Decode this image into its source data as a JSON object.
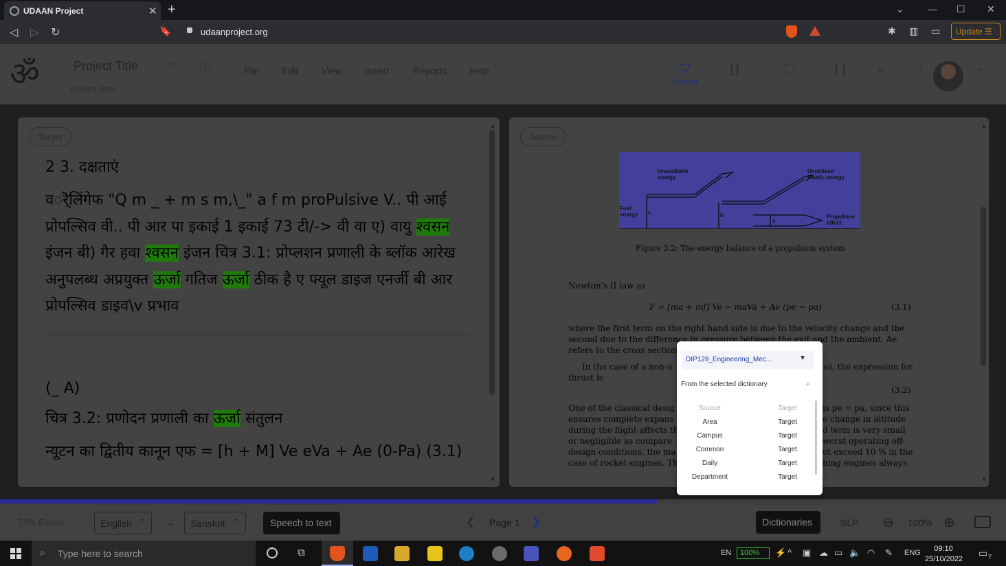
{
  "browser": {
    "tab_title": "UDAAN Project",
    "url": "udaanproject.org",
    "update_label": "Update"
  },
  "header": {
    "project_title": "Project Title",
    "file_name": "untitled.docx",
    "menu": [
      "File",
      "Edit",
      "View",
      "Insert",
      "Reports",
      "Help"
    ],
    "elements_label": "Elements"
  },
  "target_panel": {
    "chip": "Target",
    "heading": "2 3. दक्षताएं",
    "lines": [
      [
        "वर्ॆलिंगेफ \"Q m _ + m s m,\\_\" a f m proPulsive V.. पी आई",
        ""
      ],
      [
        "प्रोपल्सिव वी.. पी आर पा इकाई 1 इकाई 73 टी/-> वी वा ए) वायु ",
        "श्वसन"
      ],
      [
        "इंजन बी) गैर हवा ",
        "श्वसन",
        " इंजन चित्र 3.1: प्रोप्लशन प्रणाली के ब्लॉक आरेख"
      ],
      [
        "अनुपलब्ध अप्रयुक्त ",
        "ऊर्जा",
        " गतिज ",
        "ऊर्जा",
        " ठीक है ए फ्यूल डाइज एनर्जी बी आर"
      ],
      [
        "प्रोपल्सिव डाइव\\v प्रभाव"
      ]
    ],
    "section": "(_ A)",
    "caption_pre": "चित्र 3.2: प्रणोदन प्रणाली का ",
    "caption_hl": "ऊर्जा",
    "caption_post": " संतुलन",
    "newton": "न्यूटन का द्वितीय कानून एफ = [h + M] Ve eVa + Ae (0-Pa) (3.1)"
  },
  "source_panel": {
    "chip": "Source",
    "figure_labels": {
      "unavailable": "Unavailable energy",
      "unutilised": "Unutilised kinetic energy",
      "fuel": "Fuel energy",
      "propulsive": "Propulsive effect",
      "a": "a",
      "b": "b",
      "c": "c"
    },
    "figure_caption": "Figure 3.2: The energy balance of a propulsion system",
    "newton_line": "Newton's II law as",
    "equation": "F = [ṁa + ṁf] Ve − ṁaVa + Ae (pe − pa)",
    "eq_number": "(3.1)",
    "eq_number2": "(3.2)",
    "para1": [
      "where the first term on the right hand side is due to the velocity change and the",
      "second due to the difference in pressure between the exit and the ambient.  Ae",
      "refers to the cross section"
    ],
    "para2_left": "In the case of a non-a",
    "para2_right": "e), the expression for",
    "para2_end": "thrust is",
    "para3_left": [
      "One of the classical desig",
      "ensures complete expans",
      "during the flight affects th",
      "or negligible as compare",
      "design conditions, the ma",
      "case of rocket engines. Th"
    ],
    "para3_right": [
      "is pe = pa, since this",
      "e change in altitude",
      "d term is very small",
      "worst operating off-",
      "ot exceed 10 % in the",
      "hing engines always"
    ]
  },
  "dictionary": {
    "selected": "DIP129_Engineering_Mec...",
    "subtitle": "From the selected dictionary",
    "col_source": "Source",
    "col_target": "Target",
    "rows": [
      {
        "source": "Area",
        "target": "Target"
      },
      {
        "source": "Campus",
        "target": "Target"
      },
      {
        "source": "Common",
        "target": "Target"
      },
      {
        "source": "Daily",
        "target": "Target"
      },
      {
        "source": "Department",
        "target": "Target"
      }
    ]
  },
  "footer": {
    "edited": "73% Edited",
    "progress": 0.653,
    "source_lang": "English",
    "target_lang": "Sanskrit",
    "speech": "Speech to text",
    "page": "Page 1",
    "dictionaries": "Dictionaries",
    "slp": "SLP",
    "zoom": "100%"
  },
  "taskbar": {
    "search_placeholder": "Type here to search",
    "lang_short": "EN",
    "battery": "100%",
    "keyboard": "ENG",
    "time": "09:10",
    "date": "25/10/2022",
    "notif_count": "7"
  }
}
